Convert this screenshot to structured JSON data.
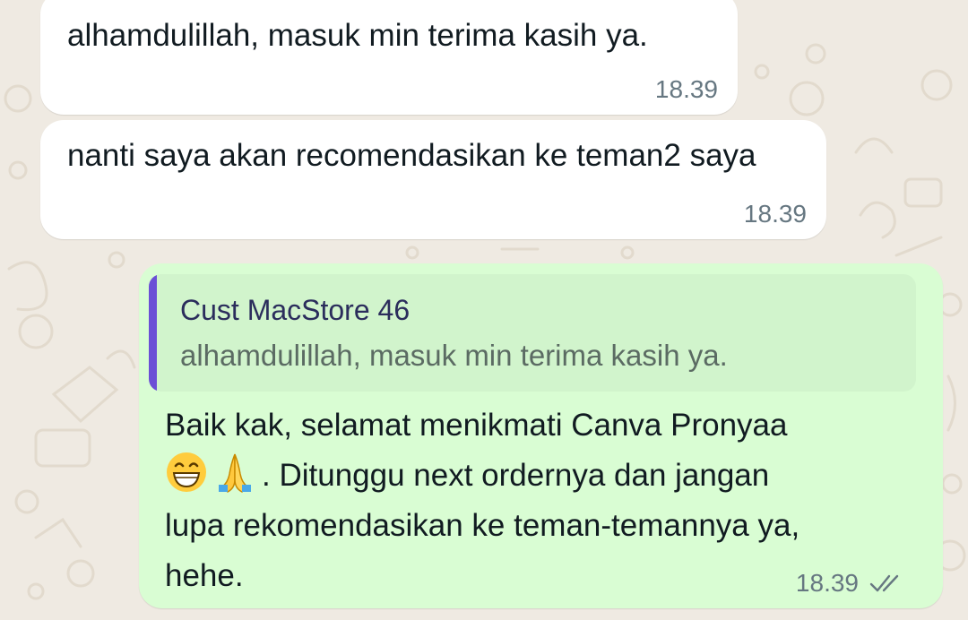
{
  "messages": [
    {
      "direction": "incoming",
      "text": "alhamdulillah, masuk min terima kasih ya.",
      "time": "18.39"
    },
    {
      "direction": "incoming",
      "text": "nanti saya akan recomendasikan ke teman2 saya",
      "time": "18.39"
    },
    {
      "direction": "outgoing",
      "quoted": {
        "author": "Cust MacStore 46",
        "text": "alhamdulillah, masuk min terima kasih ya."
      },
      "text_line1": "Baik kak, selamat menikmati Canva Pronyaa",
      "emojis": [
        "grinning-face-emoji",
        "folded-hands-emoji"
      ],
      "text_line2": ". Ditunggu next ordernya dan jangan",
      "text_line3": "lupa rekomendasikan ke teman-temannya ya,",
      "text_line4": "hehe.",
      "time": "18.39",
      "status_icon": "double-check-icon"
    }
  ],
  "colors": {
    "wallpaper": "#efeae2",
    "incoming_bubble": "#ffffff",
    "outgoing_bubble": "#d9fdd3",
    "quote_background": "#d1f4cc",
    "quote_bar": "#6b4fd6",
    "timestamp": "#667781",
    "text": "#111b21"
  }
}
